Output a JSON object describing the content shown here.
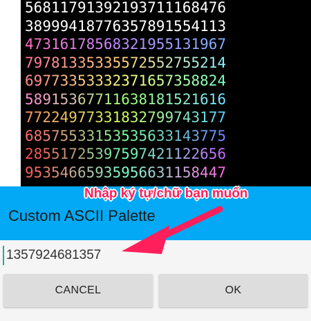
{
  "preview": {
    "ascii_rows": [
      "56811791392193711168476",
      "38999418776357891554113",
      "47316178568321955131967",
      "79781335335572552755214",
      "69773353332371657358824",
      "58915367711638181521616",
      "77224977331832799743177",
      "68575533153535633143775",
      "28551725397597421122656",
      "95354665935956631158447"
    ],
    "row_colors": [
      [
        "#ffffff",
        "#ffffff",
        "#ffffff"
      ],
      [
        "#ffffff",
        "#ffffff",
        "#ffffff"
      ],
      [
        "#ff6ec7",
        "#b98cff",
        "#7fb3ff"
      ],
      [
        "#ff7a9a",
        "#ffd27a",
        "#8ff0ff"
      ],
      [
        "#ff8a8a",
        "#f5ff7a",
        "#7affc8"
      ],
      [
        "#ff8fd0",
        "#9eff7a",
        "#7ae0ff"
      ],
      [
        "#ff9a5c",
        "#caff5c",
        "#5cd6ff"
      ],
      [
        "#ff6a6a",
        "#7aff9a",
        "#6a8aff"
      ],
      [
        "#ff4e4e",
        "#6affb0",
        "#c46aff"
      ],
      [
        "#ff5e5e",
        "#7affd0",
        "#ff6ae0"
      ]
    ]
  },
  "dialog": {
    "title": "Custom ASCII Palette",
    "header_color": "#03a9f4",
    "input_value": "1357924681357",
    "cancel_label": "CANCEL",
    "ok_label": "OK"
  },
  "annotation": {
    "label": "Nhập ký tự/chữ bạn muốn",
    "color": "#ff1f5a"
  }
}
